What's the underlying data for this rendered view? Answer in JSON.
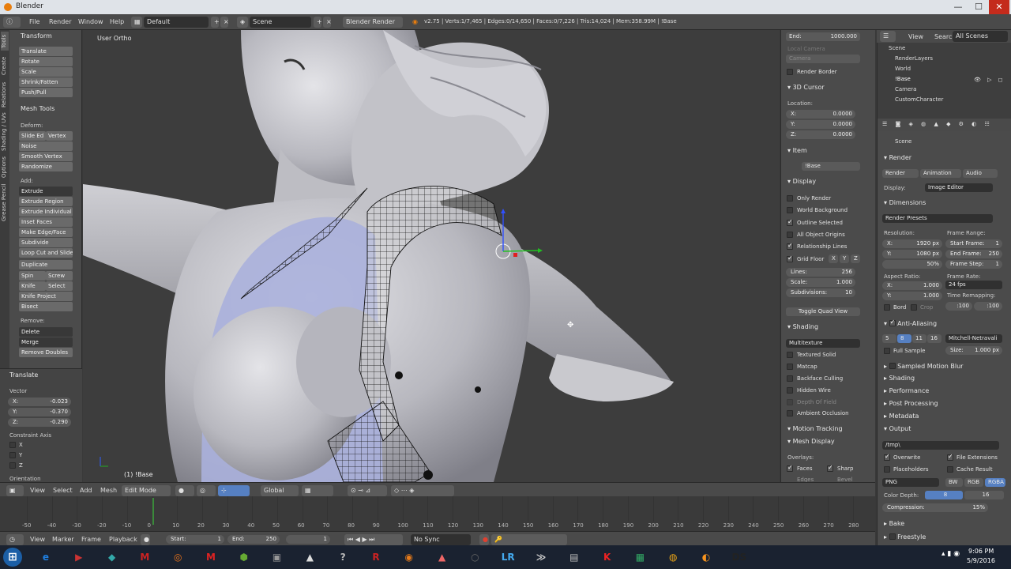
{
  "window": {
    "title": "Blender",
    "min": "—",
    "max": "☐",
    "close": "✕"
  },
  "info_header": {
    "menus": [
      "File",
      "Render",
      "Window",
      "Help"
    ],
    "screen": "Default",
    "scene": "Scene",
    "engine": "Blender Render",
    "stats": "v2.75 | Verts:1/7,465 | Edges:0/14,650 | Faces:0/7,226 | Tris:14,024 | Mem:358.99M | !Base"
  },
  "tool_tabs": [
    "Tools",
    "Create",
    "Relations",
    "Shading / UVs",
    "Options",
    "Grease Pencil"
  ],
  "tools": {
    "transform_title": "Transform",
    "transform_buttons": [
      "Translate",
      "Rotate",
      "Scale",
      "Shrink/Fatten",
      "Push/Pull"
    ],
    "mesh_tools_title": "Mesh Tools",
    "deform_label": "Deform:",
    "slide_edge": "Slide Ed",
    "vertex": "Vertex",
    "deform_buttons": [
      "Noise",
      "Smooth Vertex",
      "Randomize"
    ],
    "add_label": "Add:",
    "add_buttons": [
      "Extrude",
      "Extrude Region",
      "Extrude Individual",
      "Inset Faces",
      "Make Edge/Face",
      "Subdivide",
      "Loop Cut and Slide",
      "Duplicate"
    ],
    "spin": "Spin",
    "screw": "Screw",
    "knife": "Knife",
    "select": "Select",
    "after_buttons": [
      "Knife Project",
      "Bisect"
    ],
    "remove_label": "Remove:",
    "remove_buttons": [
      "Delete",
      "Merge",
      "Remove Doubles"
    ],
    "op_title": "Translate",
    "vector_label": "Vector",
    "vec_x": "-0.023",
    "vec_y": "-0.370",
    "vec_z": "-0.290",
    "constraint_label": "Constraint Axis",
    "cx": "X",
    "cy": "Y",
    "cz": "Z",
    "orientation_label": "Orientation"
  },
  "viewport": {
    "view_name": "User Ortho",
    "object_label": "(1) !Base"
  },
  "npanel": {
    "end_label": "End:",
    "end_value": "1000.000",
    "local_camera": "Local Camera",
    "camera": "Camera",
    "render_border": "Render Border",
    "cursor_title": "3D Cursor",
    "location": "Location:",
    "cx": "0.0000",
    "cy": "0.0000",
    "cz": "0.0000",
    "item_title": "Item",
    "item_name": "!Base",
    "display_title": "Display",
    "display_opts": [
      "Only Render",
      "World Background",
      "Outline Selected",
      "All Object Origins",
      "Relationship Lines"
    ],
    "grid_floor": "Grid Floor",
    "gx": "X",
    "gy": "Y",
    "gz": "Z",
    "lines": "Lines:",
    "lines_v": "256",
    "scale": "Scale:",
    "scale_v": "1.000",
    "subdiv": "Subdivisions:",
    "subdiv_v": "10",
    "toggle_quad": "Toggle Quad View",
    "shading_title": "Shading",
    "shading_mode": "Multitexture",
    "shading_opts": [
      "Textured Solid",
      "Matcap",
      "Backface Culling",
      "Hidden Wire",
      "Depth Of Field",
      "Ambient Occlusion"
    ],
    "motion_tracking": "Motion Tracking",
    "mesh_display": "Mesh Display",
    "overlays": "Overlays:",
    "faces": "Faces",
    "sharp": "Sharp",
    "edges": "Edges",
    "bevel": "Bevel"
  },
  "view3d_header": {
    "menus": [
      "View",
      "Select",
      "Add",
      "Mesh"
    ],
    "mode": "Edit Mode",
    "orientation": "Global"
  },
  "timeline": {
    "ticks": [
      "-50",
      "-40",
      "-30",
      "-20",
      "-10",
      "0",
      "10",
      "20",
      "30",
      "40",
      "50",
      "60",
      "70",
      "80",
      "90",
      "100",
      "110",
      "120",
      "130",
      "140",
      "150",
      "160",
      "170",
      "180",
      "190",
      "200",
      "210",
      "220",
      "230",
      "240",
      "250",
      "260",
      "270",
      "280"
    ],
    "menus": [
      "View",
      "Marker",
      "Frame",
      "Playback"
    ],
    "start": "Start:",
    "start_v": "1",
    "end": "End:",
    "end_v": "250",
    "current": "1",
    "sync": "No Sync"
  },
  "outliner": {
    "menus": [
      "View",
      "Search"
    ],
    "filter": "All Scenes",
    "rows": [
      "Scene",
      "RenderLayers",
      "World",
      "!Base",
      "Camera",
      "CustomCharacter"
    ]
  },
  "properties": {
    "breadcrumb": "Scene",
    "render_title": "Render",
    "tabs": [
      "Render",
      "Animation",
      "Audio"
    ],
    "display_label": "Display:",
    "display_value": "Image Editor",
    "dimensions": "Dimensions",
    "presets": "Render Presets",
    "resolution": "Resolution:",
    "res_x": "1920 px",
    "res_y": "1080 px",
    "res_pct": "50%",
    "frame_range": "Frame Range:",
    "start_frame": "Start Frame:",
    "start_frame_v": "1",
    "end_frame": "End Frame:",
    "end_frame_v": "250",
    "frame_step": "Frame Step:",
    "frame_step_v": "1",
    "aspect": "Aspect Ratio:",
    "asp_x": "1.000",
    "asp_y": "1.000",
    "frame_rate": "Frame Rate:",
    "fps": "24 fps",
    "bord": "Bord",
    "crop": "Crop",
    "time_remap": "Time Remapping:",
    "remap_old": ":100",
    "remap_new": ":100",
    "aa_title": "Anti-Aliasing",
    "aa_samples": [
      "5",
      "8",
      "11",
      "16"
    ],
    "aa_filter": "Mitchell-Netravali",
    "full_sample": "Full Sample",
    "size_label": "Size:",
    "size_value": "1.000 px",
    "collapsed": [
      "Sampled Motion Blur",
      "Shading",
      "Performance",
      "Post Processing",
      "Metadata"
    ],
    "output": "Output",
    "output_path": "/tmp\\",
    "overwrite": "Overwrite",
    "file_ext": "File Extensions",
    "placeholders": "Placeholders",
    "cache_result": "Cache Result",
    "format": "PNG",
    "bw": "BW",
    "rgb": "RGB",
    "rgba": "RGBA",
    "color_depth": "Color Depth:",
    "cd8": "8",
    "cd16": "16",
    "compression": "Compression:",
    "compression_v": "15%",
    "bake": "Bake",
    "freestyle": "Freestyle"
  },
  "taskbar": {
    "time": "9:06 PM",
    "date": "5/9/2016",
    "icons": [
      "e",
      "▶",
      "◆",
      "M",
      "◎",
      "M",
      "⬢",
      "▣",
      "▲",
      "?",
      "R",
      "◉",
      "▲",
      "○",
      "LR",
      "≫",
      "▤",
      "K",
      "▦",
      "◍",
      "◐",
      "DS"
    ],
    "colors": [
      "#1f7fe0",
      "#c33",
      "#3aa",
      "#c22",
      "#e8731b",
      "#d22",
      "#6a3",
      "#999",
      "#ddd",
      "#bbb",
      "#c22",
      "#e77b1a",
      "#e66",
      "#666",
      "#4ae",
      "#ccc",
      "#bbb",
      "#e22",
      "#3a6",
      "#e8a317",
      "#f7931e",
      "#222"
    ]
  }
}
